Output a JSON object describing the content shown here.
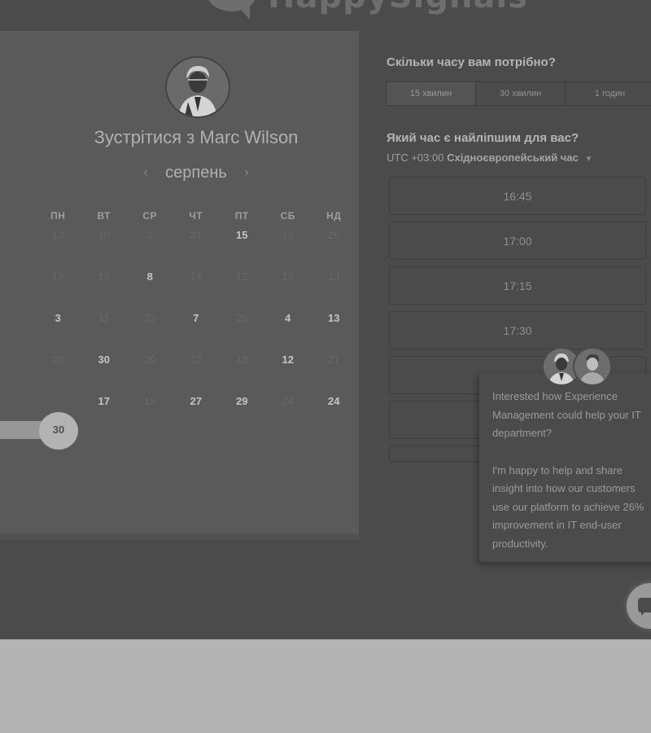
{
  "brand": {
    "name": "HappySignals",
    "colors": {
      "logo": "#6e6e6e"
    }
  },
  "scheduler": {
    "meet_title": "Зустрітися з Marc Wilson",
    "month": "серпень",
    "prev_icon": "chevron-left-icon",
    "next_icon": "chevron-right-icon",
    "weekdays": [
      "ПН",
      "ВТ",
      "СР",
      "ЧТ",
      "ПТ",
      "СБ",
      "НД"
    ],
    "weeks": [
      [
        {
          "d": "13",
          "s": "dim"
        },
        {
          "d": "10",
          "s": "dim"
        },
        {
          "d": "2",
          "s": "dim"
        },
        {
          "d": "31",
          "s": "dim"
        },
        {
          "d": "15",
          "s": "avail"
        },
        {
          "d": "16",
          "s": "dim"
        },
        {
          "d": "26",
          "s": "dim"
        }
      ],
      [
        {
          "d": "18",
          "s": "dim"
        },
        {
          "d": "15",
          "s": "dim"
        },
        {
          "d": "8",
          "s": "avail"
        },
        {
          "d": "14",
          "s": "dim"
        },
        {
          "d": "12",
          "s": "dim"
        },
        {
          "d": "16",
          "s": "dim"
        },
        {
          "d": "13",
          "s": "dim"
        }
      ],
      [
        {
          "d": "3",
          "s": "avail"
        },
        {
          "d": "11",
          "s": "dim"
        },
        {
          "d": "23",
          "s": "dim"
        },
        {
          "d": "7",
          "s": "avail"
        },
        {
          "d": "25",
          "s": "dim"
        },
        {
          "d": "4",
          "s": "avail"
        },
        {
          "d": "13",
          "s": "avail"
        }
      ],
      [
        {
          "d": "29",
          "s": "dim"
        },
        {
          "d": "30",
          "s": "avail"
        },
        {
          "d": "20",
          "s": "dim"
        },
        {
          "d": "22",
          "s": "dim"
        },
        {
          "d": "13",
          "s": "dim"
        },
        {
          "d": "12",
          "s": "avail"
        },
        {
          "d": "21",
          "s": "dim"
        }
      ],
      [
        {
          "d": "30",
          "s": "selected"
        },
        {
          "d": "17",
          "s": "avail"
        },
        {
          "d": "19",
          "s": "dim"
        },
        {
          "d": "27",
          "s": "avail"
        },
        {
          "d": "29",
          "s": "avail"
        },
        {
          "d": "24",
          "s": "dim"
        },
        {
          "d": "24",
          "s": "avail"
        }
      ]
    ],
    "selected_day": "30"
  },
  "duration": {
    "question": "Скільки часу вам потрібно?",
    "options": [
      "15 хвилин",
      "30 хвилин",
      "1 годин"
    ],
    "selected": "15 хвилин"
  },
  "times": {
    "question": "Який час є найліпшим для вас?",
    "tz_offset": "UTC +03:00",
    "tz_name": "Східноєвропейський час",
    "slots": [
      "16:45",
      "17:00",
      "17:15",
      "17:30",
      "",
      "",
      ""
    ]
  },
  "chat": {
    "lines_1": [
      "Interested how Experience",
      "Management could help your IT",
      "department?"
    ],
    "lines_2": [
      "I'm happy to help and share",
      "insight into how our customers",
      "use our platform to achieve 26%",
      "improvement in IT end-user",
      "productivity."
    ],
    "fab_icon": "chat-bubble-icon"
  }
}
